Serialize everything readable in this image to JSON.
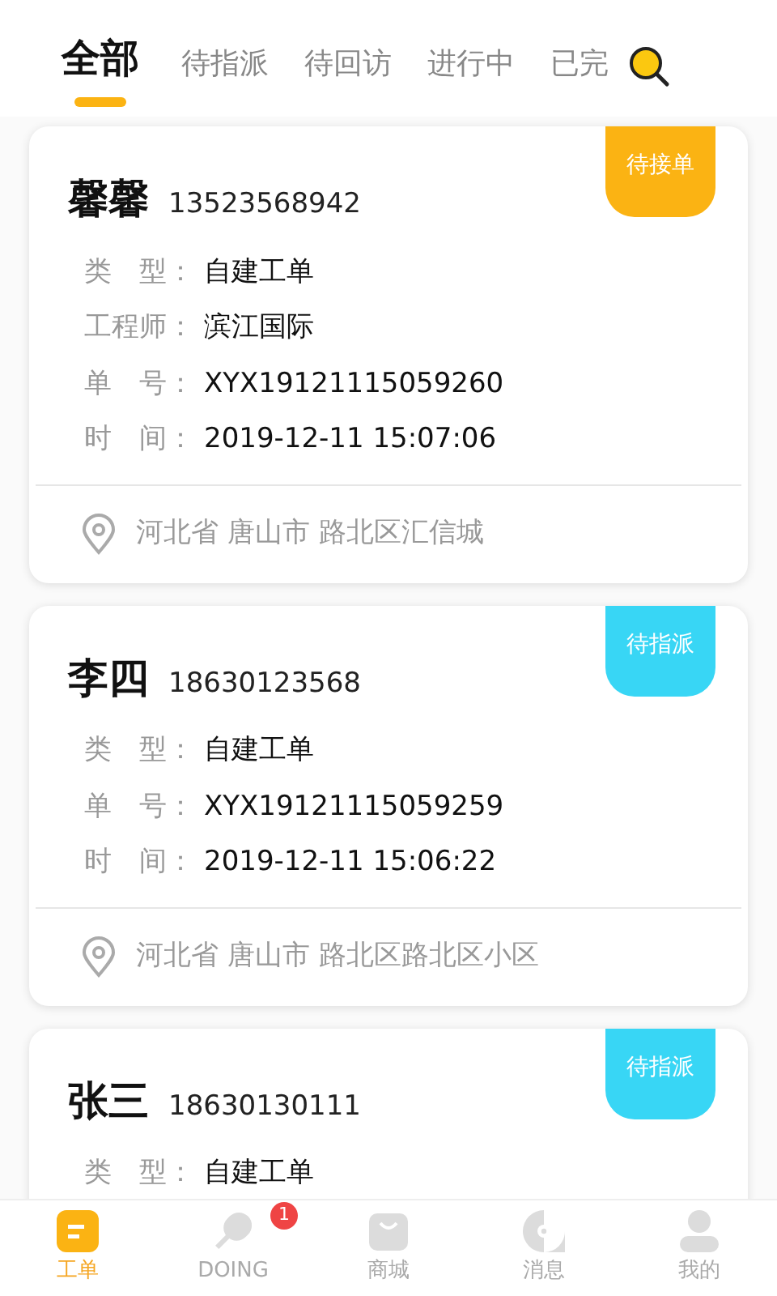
{
  "tabs": [
    {
      "label": "全部",
      "selected": true
    },
    {
      "label": "待指派",
      "selected": false
    },
    {
      "label": "待回访",
      "selected": false
    },
    {
      "label": "进行中",
      "selected": false
    },
    {
      "label": "已完",
      "selected": false
    }
  ],
  "orders": [
    {
      "name": "馨馨",
      "phone": "13523568942",
      "status": {
        "label": "待接单",
        "color": "#fbb313"
      },
      "fields": [
        {
          "label": "类　型：",
          "value": "自建工单"
        },
        {
          "label": "工程师：",
          "value": "滨江国际"
        },
        {
          "label": "单　号：",
          "value": "XYX19121115059260"
        },
        {
          "label": "时　间：",
          "value": "2019-12-11 15:07:06"
        }
      ],
      "address": "河北省 唐山市 路北区汇信城"
    },
    {
      "name": "李四",
      "phone": "18630123568",
      "status": {
        "label": "待指派",
        "color": "#38d6f5"
      },
      "fields": [
        {
          "label": "类　型：",
          "value": "自建工单"
        },
        {
          "label": "单　号：",
          "value": "XYX19121115059259"
        },
        {
          "label": "时　间：",
          "value": "2019-12-11 15:06:22"
        }
      ],
      "address": "河北省 唐山市 路北区路北区小区"
    },
    {
      "name": "张三",
      "phone": "18630130111",
      "status": {
        "label": "待指派",
        "color": "#38d6f5"
      },
      "fields": [
        {
          "label": "类　型：",
          "value": "自建工单"
        }
      ]
    }
  ],
  "nav": [
    {
      "kind": "orders",
      "label": "工单",
      "selected": true
    },
    {
      "kind": "doing",
      "label": "DOING",
      "selected": false,
      "badge": "1"
    },
    {
      "kind": "shop",
      "label": "商城",
      "selected": false
    },
    {
      "kind": "message",
      "label": "消息",
      "selected": false
    },
    {
      "kind": "profile",
      "label": "我的",
      "selected": false
    }
  ]
}
